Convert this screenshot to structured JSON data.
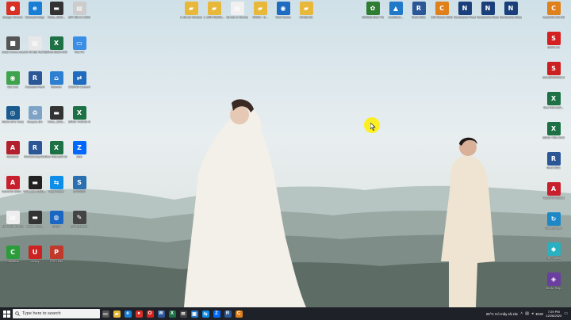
{
  "desktop": {
    "left_icons": [
      {
        "label": "Google Chrome",
        "icon": "chrome-icon",
        "color": "#d93025",
        "glyph": "●"
      },
      {
        "label": "Microsoft Edge",
        "icon": "edge-icon",
        "color": "#1a7fd4",
        "glyph": "e"
      },
      {
        "label": "Video_2023...",
        "icon": "video-icon",
        "color": "#333333",
        "glyph": "▬"
      },
      {
        "label": "BẢY ĐÊ A 3 2023.xlsx",
        "icon": "file-icon",
        "color": "#cccccc",
        "glyph": "▤"
      },
      {
        "label": "Install Vrsmo AutoCAD 2020",
        "icon": "install-icon",
        "color": "#555555",
        "glyph": "■"
      },
      {
        "label": "ĐỒ ÁN BỂ NƯỚC",
        "icon": "document-icon",
        "color": "#e8e8e8",
        "glyph": "▤"
      },
      {
        "label": "BẢNG ĐIỂM GIỮA KỲ",
        "icon": "excel-icon",
        "color": "#1e7145",
        "glyph": "X"
      },
      {
        "label": "This PC",
        "icon": "computer-icon",
        "color": "#3a8ee6",
        "glyph": "▭"
      },
      {
        "label": "Cốc Cốc",
        "icon": "coccoc-icon",
        "color": "#3fa34d",
        "glyph": "◉"
      },
      {
        "label": "Autodesk Revit",
        "icon": "revit-icon",
        "color": "#2b5797",
        "glyph": "R"
      },
      {
        "label": "Network",
        "icon": "network-icon",
        "color": "#2f7fd1",
        "glyph": "⌂"
      },
      {
        "label": "CAD/ND Converter",
        "icon": "converter-icon",
        "color": "#1f6bbf",
        "glyph": "⇄"
      },
      {
        "label": "ASUS GPU Tweak",
        "icon": "gpu-icon",
        "color": "#1a5a8f",
        "glyph": "◎"
      },
      {
        "label": "Recycle Bin",
        "icon": "recycle-bin-icon",
        "color": "#7fa3c7",
        "glyph": "♻"
      },
      {
        "label": "Video_2023...",
        "icon": "video-icon",
        "color": "#333333",
        "glyph": "▬"
      },
      {
        "label": "BẢNG THỐNG KÊ",
        "icon": "excel-icon",
        "color": "#1e7145",
        "glyph": "X"
      },
      {
        "label": "Autodesk",
        "icon": "autodesk-icon",
        "color": "#b3202d",
        "glyph": "A"
      },
      {
        "label": "Worksharing Monitor for...",
        "icon": "revit-icon",
        "color": "#2b5797",
        "glyph": "R"
      },
      {
        "label": "New Microsoft Excel...",
        "icon": "excel-icon",
        "color": "#1e7145",
        "glyph": "X"
      },
      {
        "label": "Zalo",
        "icon": "zalo-icon",
        "color": "#0068ff",
        "glyph": "Z"
      },
      {
        "label": "AutoCAD 2020 - Tiếng...",
        "icon": "autocad-icon",
        "color": "#c8202d",
        "glyph": "A"
      },
      {
        "label": "BẢN ĐỒ PHẦN...",
        "icon": "image-icon",
        "color": "#222222",
        "glyph": "▬"
      },
      {
        "label": "TeamViewer",
        "icon": "teamviewer-icon",
        "color": "#0e8ee9",
        "glyph": "⇆"
      },
      {
        "label": "SAP2000",
        "icon": "sap-icon",
        "color": "#2a6fb0",
        "glyph": "S"
      },
      {
        "label": "BẢN CHỈNH SỬA NGHIỆM THU",
        "icon": "file-icon",
        "color": "#eeeeee",
        "glyph": "▤"
      },
      {
        "label": "Video_2023...",
        "icon": "video-icon",
        "color": "#333333",
        "glyph": "▬"
      },
      {
        "label": "GXSP",
        "icon": "gxsp-icon",
        "color": "#1a66c2",
        "glyph": "◍"
      },
      {
        "label": "ETABS Excel",
        "icon": "etabs-icon",
        "color": "#444444",
        "glyph": "✎"
      },
      {
        "label": "Camtasia",
        "icon": "camtasia-icon",
        "color": "#2a9d3a",
        "glyph": "C"
      },
      {
        "label": "Unikey",
        "icon": "unikey-icon",
        "color": "#cc2222",
        "glyph": "U"
      },
      {
        "label": "PDFXEdit",
        "icon": "pdf-icon",
        "color": "#c0392b",
        "glyph": "P"
      }
    ],
    "top_icons": [
      {
        "label": "3. Đồ dự Shortcut",
        "icon": "folder-icon",
        "color": "#e8b83a",
        "glyph": "▰"
      },
      {
        "label": "1. BẢN NEWS...",
        "icon": "folder-icon",
        "color": "#e8b83a",
        "glyph": "▰"
      },
      {
        "label": "VE bản in Shortcut",
        "icon": "document-icon",
        "color": "#f0f0f0",
        "glyph": "▤"
      },
      {
        "label": "VRWC - S...",
        "icon": "folder-icon",
        "color": "#e8b83a",
        "glyph": "▰"
      },
      {
        "label": "Word Sumo",
        "icon": "app-icon",
        "color": "#1f6bbf",
        "glyph": "◉"
      },
      {
        "label": "Cổ Bài Đồ",
        "icon": "folder-icon",
        "color": "#e8b83a",
        "glyph": "▰"
      },
      {
        "label": "ADINSS Start Thống Kê...",
        "icon": "adinss-icon",
        "color": "#2e7d32",
        "glyph": "✿"
      },
      {
        "label": "AutoDesk...",
        "icon": "autodesk-icon",
        "color": "#1f78c8",
        "glyph": "▲"
      },
      {
        "label": "Revit 2021",
        "icon": "revit-icon",
        "color": "#2b5797",
        "glyph": "R"
      },
      {
        "label": "CSI Viewer 2019",
        "icon": "csi-icon",
        "color": "#e0801a",
        "glyph": "C"
      },
      {
        "label": "Navisworks Freedom 2016",
        "icon": "navisworks-icon",
        "color": "#1a3f7a",
        "glyph": "N"
      },
      {
        "label": "Navisworks Manage 2016",
        "icon": "navisworks-icon",
        "color": "#1a3f7a",
        "glyph": "N"
      },
      {
        "label": "Navisworks Manage 2016",
        "icon": "navisworks-icon",
        "color": "#1a3f7a",
        "glyph": "N"
      }
    ],
    "right_icons": [
      {
        "label": "AutoCAD CSI 2020",
        "icon": "csi-icon",
        "color": "#e0801a",
        "glyph": "C"
      },
      {
        "label": "SAFE 2.0",
        "icon": "safe-icon",
        "color": "#d42020",
        "glyph": "S"
      },
      {
        "label": "SOLIDWORKS 2023",
        "icon": "solidworks-icon",
        "color": "#cc1f1f",
        "glyph": "S"
      },
      {
        "label": "New Microsoft...",
        "icon": "excel-icon",
        "color": "#1e7145",
        "glyph": "X"
      },
      {
        "label": "BẢNG TÍNH KHỐI LƯỢNG",
        "icon": "excel-icon",
        "color": "#1e7145",
        "glyph": "X"
      },
      {
        "label": "Revit 2021",
        "icon": "revit-icon",
        "color": "#2b5797",
        "glyph": "R"
      },
      {
        "label": "AutoCAD Shortcut",
        "icon": "autocad-icon",
        "color": "#c8202d",
        "glyph": "A"
      },
      {
        "label": "ShareScreen",
        "icon": "share-icon",
        "color": "#1e88c7",
        "glyph": "↻"
      },
      {
        "label": "PDF Xpress",
        "icon": "pdf-icon",
        "color": "#2ab0c0",
        "glyph": "◆"
      },
      {
        "label": "Đồ Án Thép",
        "icon": "app-icon",
        "color": "#6a3fa0",
        "glyph": "◈"
      }
    ]
  },
  "taskbar": {
    "search_placeholder": "Type here to search",
    "apps": [
      {
        "icon": "task-view-icon",
        "color": "#555555",
        "glyph": "▭"
      },
      {
        "icon": "file-explorer-icon",
        "color": "#e8b83a",
        "glyph": "▰"
      },
      {
        "icon": "edge-icon",
        "color": "#1a7fd4",
        "glyph": "e"
      },
      {
        "icon": "chrome-icon",
        "color": "#d93025",
        "glyph": "●"
      },
      {
        "icon": "opera-icon",
        "color": "#d62020",
        "glyph": "O"
      },
      {
        "icon": "word-icon",
        "color": "#2b579a",
        "glyph": "W"
      },
      {
        "icon": "excel-icon",
        "color": "#1e7145",
        "glyph": "X"
      },
      {
        "icon": "mail-icon",
        "color": "#444444",
        "glyph": "✉"
      },
      {
        "icon": "photos-icon",
        "color": "#2a7bd1",
        "glyph": "▣"
      },
      {
        "icon": "teamviewer-icon",
        "color": "#0e8ee9",
        "glyph": "⇆"
      },
      {
        "icon": "zalo-icon",
        "color": "#0068ff",
        "glyph": "Z"
      },
      {
        "icon": "revit-icon",
        "color": "#2b5797",
        "glyph": "R"
      },
      {
        "icon": "camtasia-icon",
        "color": "#e0801a",
        "glyph": "C"
      }
    ],
    "weather": "28°C  Có mây rải rác",
    "language": "ENG",
    "time": "7:29 PM",
    "date": "12/26/2023"
  }
}
